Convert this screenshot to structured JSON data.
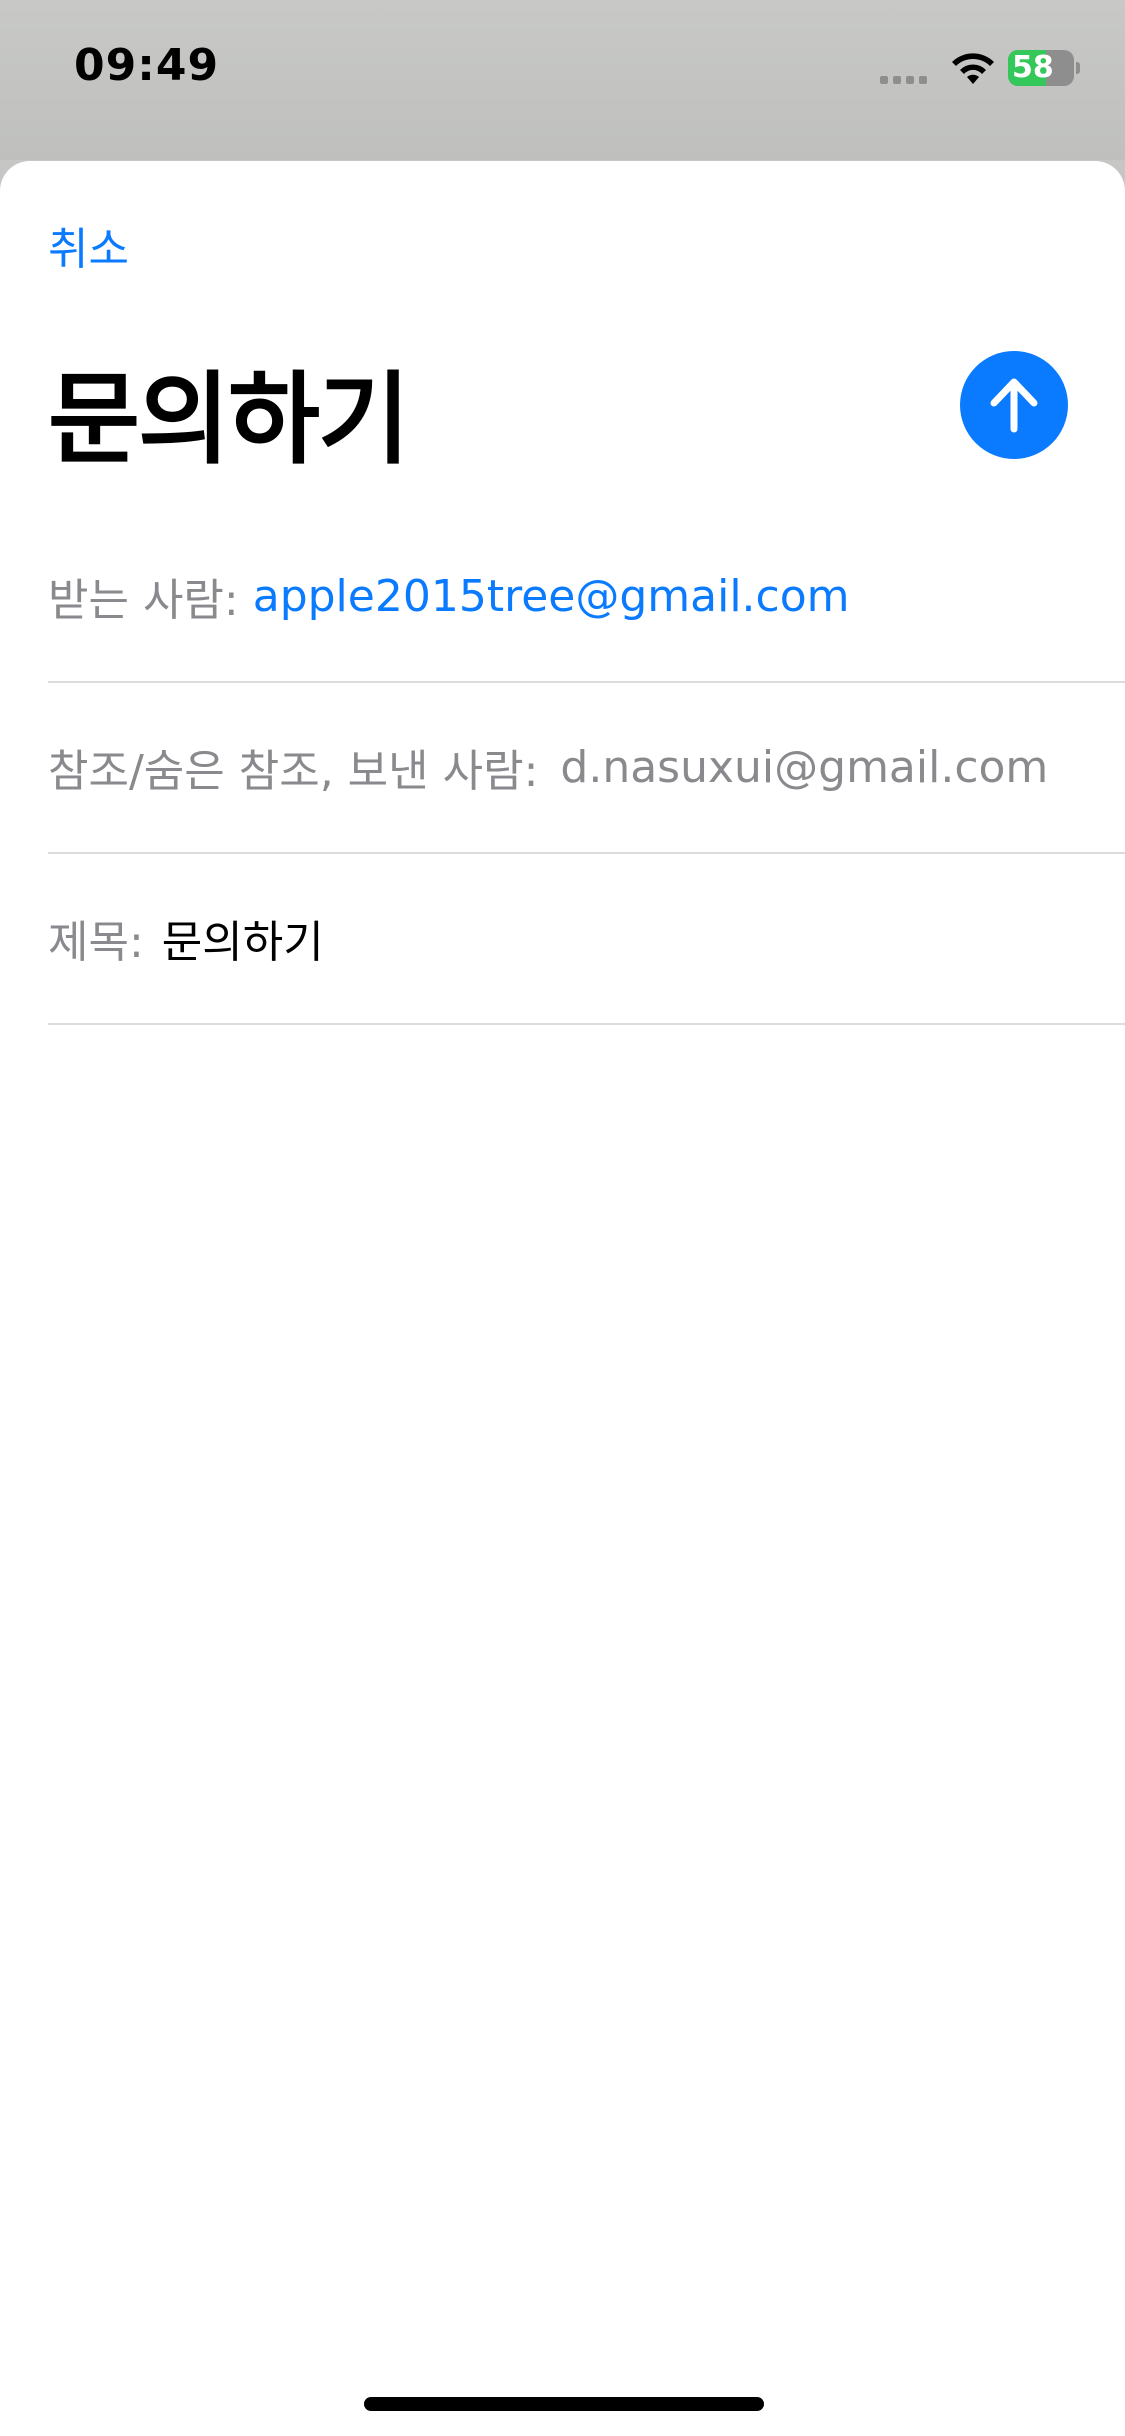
{
  "status_bar": {
    "time": "09:49",
    "battery_level_text": "58",
    "battery_percent": 58,
    "battery_charging": true,
    "icons": [
      "cellular-signal-icon",
      "wifi-icon",
      "battery-charging-icon"
    ]
  },
  "compose": {
    "cancel_label": "취소",
    "title": "문의하기",
    "send_icon": "arrow-up-icon",
    "to_label": "받는 사람:",
    "to_value": "apple2015tree@gmail.com",
    "cc_label": "참조/숨은 참조, 보낸 사람:",
    "cc_value": "d.nasuxui@gmail.com",
    "subject_label": "제목:",
    "subject_value": "문의하기"
  },
  "colors": {
    "accent": "#0a7aff",
    "label_gray": "#8a8a8e",
    "battery_green": "#34c759"
  }
}
